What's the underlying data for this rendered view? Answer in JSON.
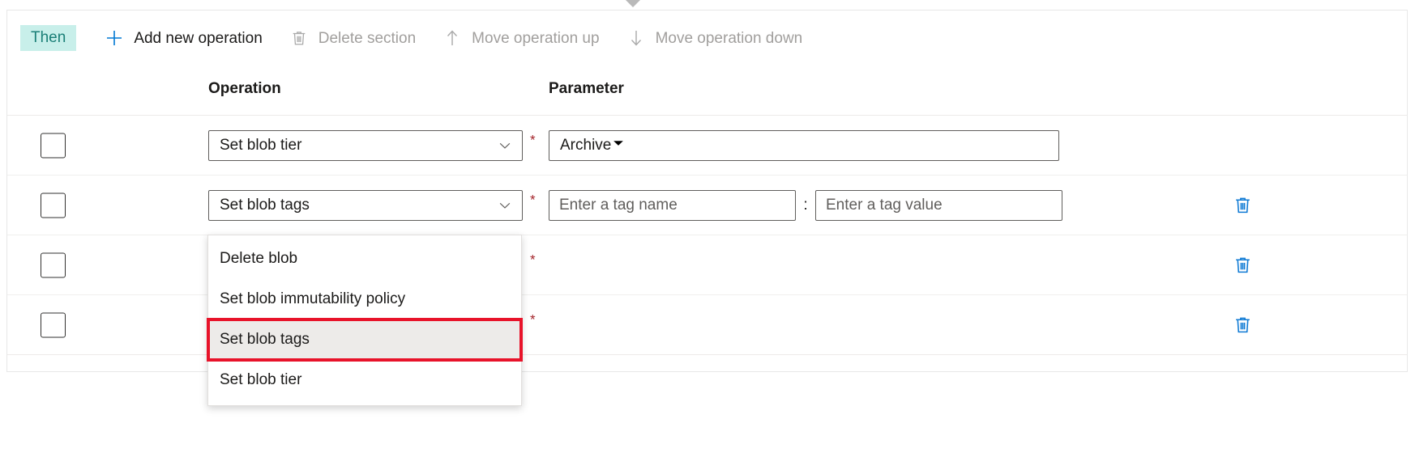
{
  "section": {
    "badge_label": "Then"
  },
  "toolbar": {
    "commands": [
      {
        "label": "Add new operation",
        "icon": "plus-icon",
        "enabled": true
      },
      {
        "label": "Delete section",
        "icon": "trash-icon",
        "enabled": false
      },
      {
        "label": "Move operation up",
        "icon": "arrow-up-icon",
        "enabled": false
      },
      {
        "label": "Move operation down",
        "icon": "arrow-down-icon",
        "enabled": false
      }
    ]
  },
  "table": {
    "headers": {
      "operation": "Operation",
      "parameter": "Parameter"
    },
    "required_marker": "*",
    "tag_separator": ":",
    "rows": [
      {
        "operation": "Set blob tier",
        "param_type": "select",
        "param_value": "Archive",
        "has_delete": false
      },
      {
        "operation": "Set blob tags",
        "param_type": "tag-pair",
        "tag_name_placeholder": "Enter a tag name",
        "tag_value_placeholder": "Enter a tag value",
        "has_delete": true
      },
      {
        "operation": "",
        "param_type": "hidden",
        "has_delete": true
      },
      {
        "operation": "",
        "param_type": "hidden",
        "has_delete": true
      }
    ]
  },
  "dropdown": {
    "open": true,
    "options": [
      "Delete blob",
      "Set blob immutability policy",
      "Set blob tags",
      "Set blob tier"
    ],
    "selected": "Set blob tags",
    "highlight_color": "#e8132a"
  },
  "colors": {
    "accent": "#0078d4",
    "badge_bg": "#c8efea",
    "badge_text": "#1a7f77",
    "required": "#a4262c",
    "delete_icon": "#0f7ad4"
  }
}
